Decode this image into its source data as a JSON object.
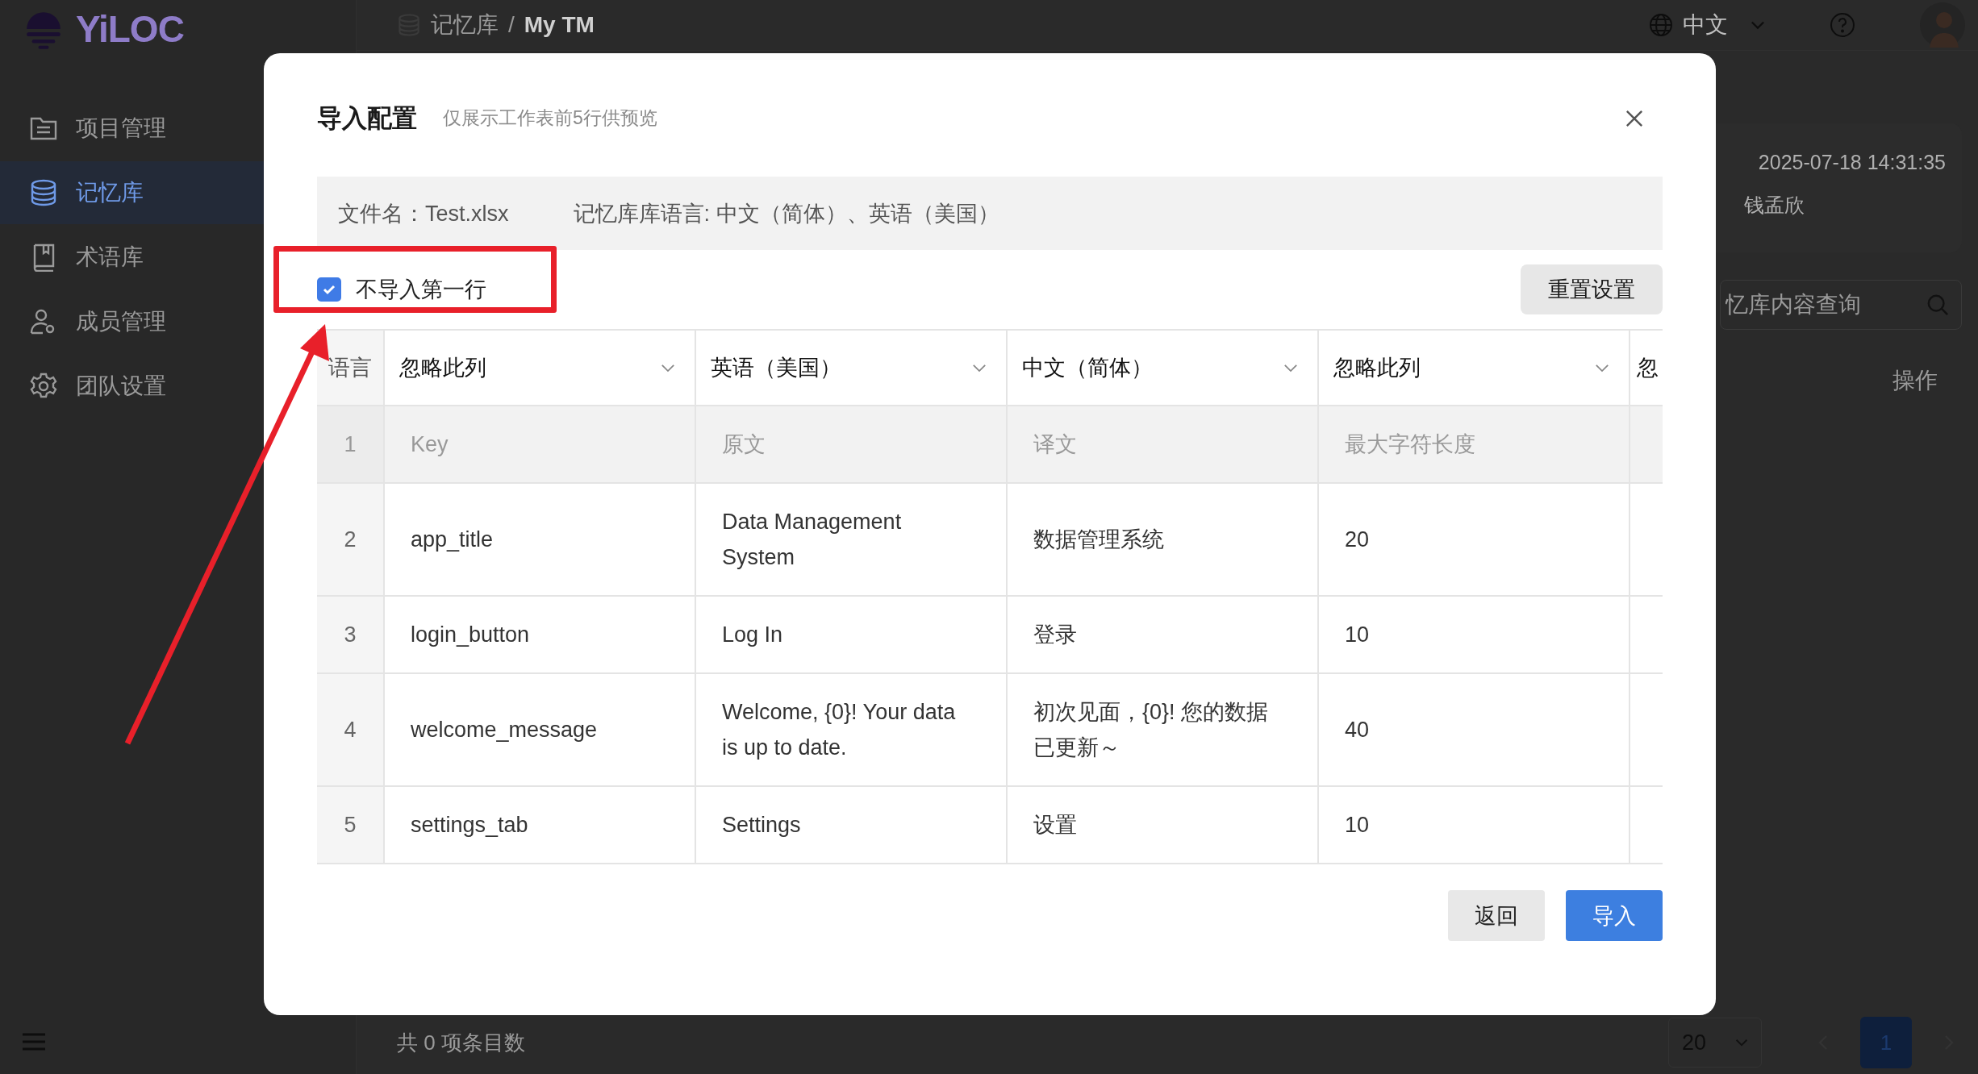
{
  "app": {
    "logo": "YiLOC",
    "breadcrumb": {
      "section": "记忆库",
      "separator": "/",
      "current": "My TM"
    },
    "language": "中文"
  },
  "sidebar": {
    "items": [
      {
        "label": "项目管理",
        "kind": "folder",
        "selected": false
      },
      {
        "label": "记忆库",
        "kind": "database",
        "selected": true
      },
      {
        "label": "术语库",
        "kind": "book",
        "selected": false
      },
      {
        "label": "成员管理",
        "kind": "member",
        "selected": false
      },
      {
        "label": "团队设置",
        "kind": "gear",
        "selected": false
      }
    ]
  },
  "content": {
    "updated_time": "2025-07-18 14:31:35",
    "owner": "钱孟欣",
    "search": {
      "placeholder": "忆库内容查询"
    },
    "table_column": "操作"
  },
  "footer": {
    "total": "共 0 项条目数",
    "page_size": "20",
    "pages": [
      {
        "label": "1",
        "selected": true
      }
    ]
  },
  "dialog": {
    "title": "导入配置",
    "subtitle": "仅展示工作表前5行供预览",
    "file_name": "文件名：Test.xlsx",
    "languages": "记忆库库语言: 中文（简体）、英语（美国）",
    "skip_first_row": {
      "label": "不导入第一行",
      "checked": true
    },
    "reset_button": "重置设置",
    "table": {
      "corner": "语言",
      "columns": [
        {
          "label": "忽略此列",
          "kind": "select"
        },
        {
          "label": "英语（美国）",
          "kind": "select"
        },
        {
          "label": "中文（简体）",
          "kind": "select"
        },
        {
          "label": "忽略此列",
          "kind": "select"
        },
        {
          "label": "忽",
          "kind": "clipped"
        }
      ],
      "rows": [
        {
          "index": "1",
          "skipped": true,
          "cells": [
            "Key",
            "原文",
            "译文",
            "最大字符长度"
          ]
        },
        {
          "index": "2",
          "skipped": false,
          "cells": [
            "app_title",
            "Data Management System",
            "数据管理系统",
            "20"
          ]
        },
        {
          "index": "3",
          "skipped": false,
          "cells": [
            "login_button",
            "Log In",
            "登录",
            "10"
          ]
        },
        {
          "index": "4",
          "skipped": false,
          "cells": [
            "welcome_message",
            "Welcome, {0}! Your data is up to date.",
            "初次见面，{0}! 您的数据已更新～",
            "40"
          ]
        },
        {
          "index": "5",
          "skipped": false,
          "cells": [
            "settings_tab",
            "Settings",
            "设置",
            "10"
          ]
        }
      ]
    },
    "buttons": [
      {
        "label": "返回",
        "kind": "secondary"
      },
      {
        "label": "导入",
        "kind": "primary"
      }
    ]
  }
}
